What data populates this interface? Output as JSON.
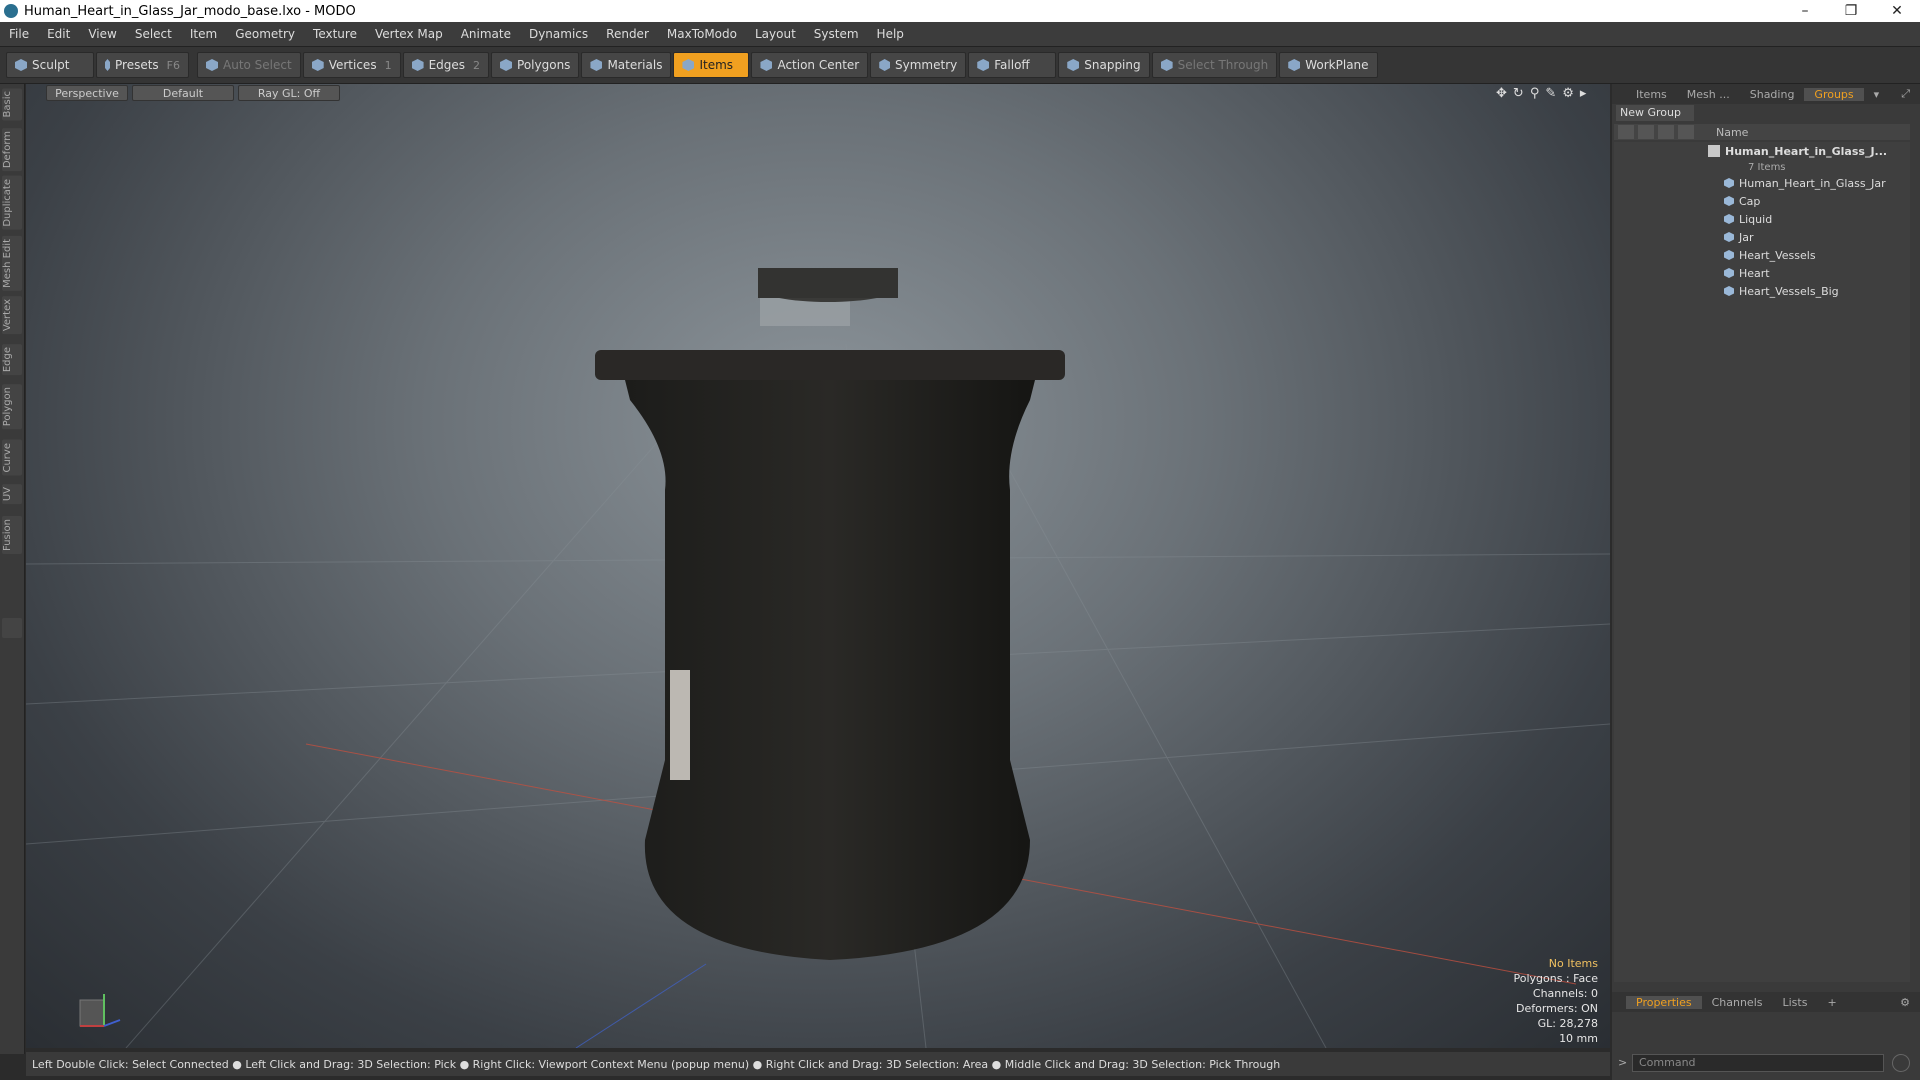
{
  "window": {
    "title": "Human_Heart_in_Glass_Jar_modo_base.lxo - MODO"
  },
  "menu": [
    "File",
    "Edit",
    "View",
    "Select",
    "Item",
    "Geometry",
    "Texture",
    "Vertex Map",
    "Animate",
    "Dynamics",
    "Render",
    "MaxToModo",
    "Layout",
    "System",
    "Help"
  ],
  "toolbar": {
    "sculpt": "Sculpt",
    "presets": "Presets",
    "presets_key": "F6",
    "auto_select": "Auto Select",
    "vertices": "Vertices",
    "vertices_key": "1",
    "edges": "Edges",
    "edges_key": "2",
    "polygons": "Polygons",
    "materials": "Materials",
    "items": "Items",
    "action_center": "Action Center",
    "symmetry": "Symmetry",
    "falloff": "Falloff",
    "snapping": "Snapping",
    "select_through": "Select Through",
    "workplane": "WorkPlane"
  },
  "left_tabs": [
    "Basic",
    "Deform",
    "Duplicate",
    "Mesh Edit",
    "Vertex",
    "Edge",
    "Polygon",
    "Curve",
    "UV",
    "Fusion"
  ],
  "viewport": {
    "view": "Perspective",
    "shading": "Default",
    "raygl": "Ray GL: Off"
  },
  "info": {
    "selection": "No Items",
    "polygons": "Polygons : Face",
    "channels": "Channels: 0",
    "deformers": "Deformers: ON",
    "gl": "GL: 28,278",
    "unit": "10 mm"
  },
  "status": "Left Double Click: Select Connected ● Left Click and Drag: 3D Selection: Pick ● Right Click: Viewport Context Menu (popup menu) ● Right Click and Drag: 3D Selection: Area ● Middle Click and Drag: 3D Selection: Pick Through",
  "right_tabs": [
    "Items",
    "Mesh ...",
    "Shading",
    "Groups"
  ],
  "new_group": "New Group",
  "tree": {
    "name_header": "Name",
    "root": "Human_Heart_in_Glass_J...",
    "root_count": "7 Items",
    "items": [
      "Human_Heart_in_Glass_Jar",
      "Cap",
      "Liquid",
      "Jar",
      "Heart_Vessels",
      "Heart",
      "Heart_Vessels_Big"
    ]
  },
  "bottom_tabs": [
    "Properties",
    "Channels",
    "Lists",
    "+"
  ],
  "command": {
    "placeholder": "Command"
  },
  "colors": {
    "accent": "#f0a020"
  }
}
